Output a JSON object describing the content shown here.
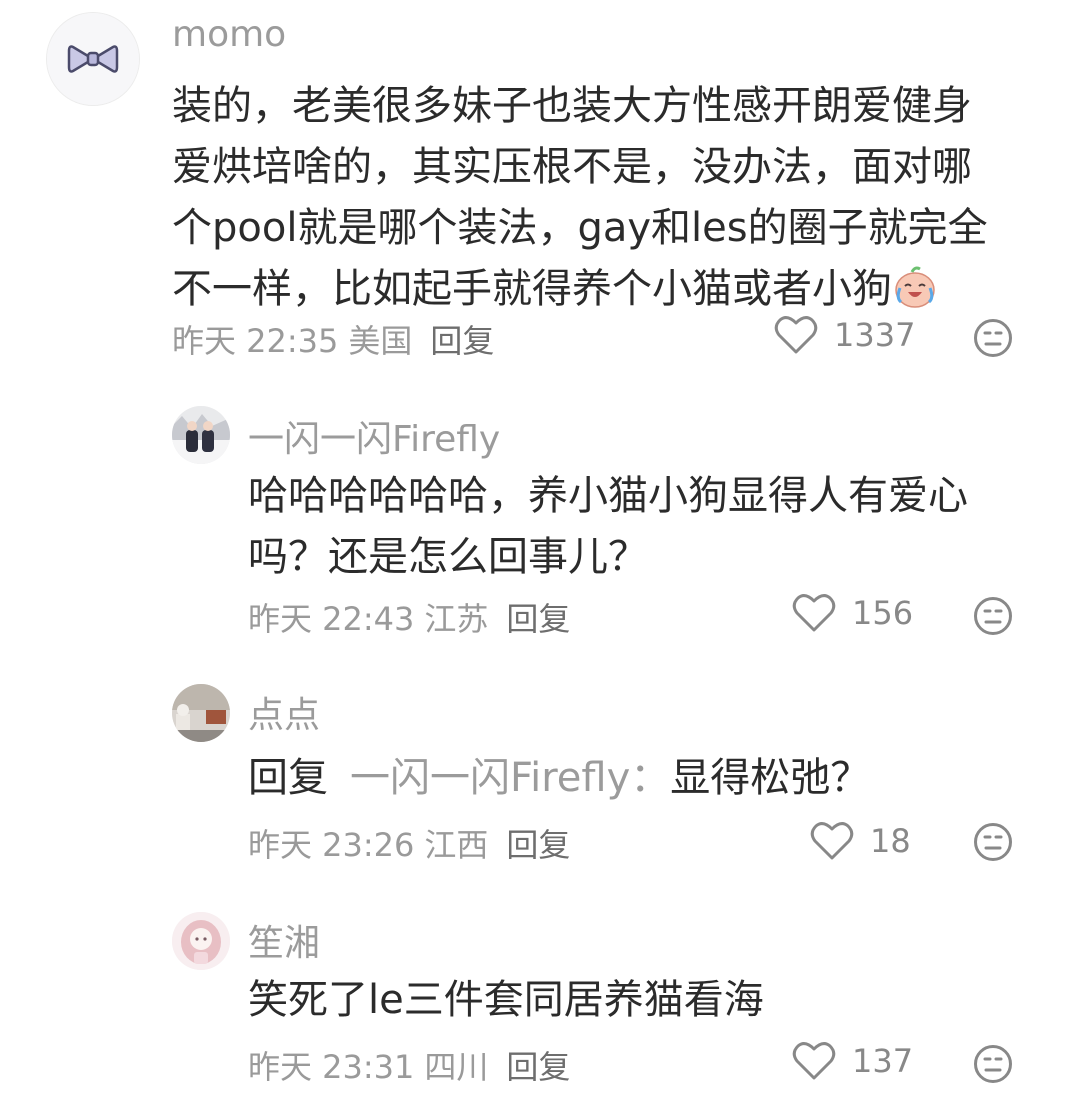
{
  "comments": [
    {
      "username": "momo",
      "avatar_icon": "bow-avatar-icon",
      "content_lines": [
        "装的，老美很多妹子也装大方性感开朗爱健身",
        "爱烘培啥的，其实压根不是，没办法，面对哪",
        "个pool就是哪个装法，gay和les的圈子就完全",
        "不一样，比如起手就得养个小猫或者小狗"
      ],
      "emoji": "crying-laughing-emoji",
      "time": "昨天 22:35",
      "location": "美国",
      "reply_label": "回复",
      "likes": "1337"
    },
    {
      "username": "一闪一闪Firefly",
      "avatar_icon": "winter-photo-avatar",
      "content_lines": [
        "哈哈哈哈哈哈，养小猫小狗显得人有爱心",
        "吗？还是怎么回事儿？"
      ],
      "time": "昨天 22:43",
      "location": "江苏",
      "reply_label": "回复",
      "likes": "156"
    },
    {
      "username": "点点",
      "avatar_icon": "room-photo-avatar",
      "reply_prefix": "回复",
      "reply_target": "一闪一闪Firefly：",
      "content": "显得松弛？",
      "time": "昨天 23:26",
      "location": "江西",
      "reply_label": "回复",
      "likes": "18"
    },
    {
      "username": "笙湘",
      "avatar_icon": "anime-girl-avatar",
      "content": "笑死了le三件套同居养猫看海",
      "time": "昨天 23:31",
      "location": "四川",
      "reply_label": "回复",
      "likes": "137"
    }
  ]
}
